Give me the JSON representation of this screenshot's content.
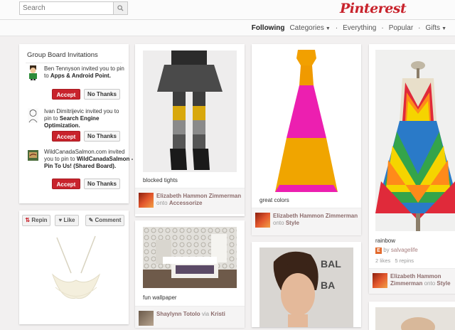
{
  "header": {
    "search_placeholder": "Search",
    "logo": "Pinterest",
    "brand_color": "#c8232c"
  },
  "nav": {
    "following": "Following",
    "categories": "Categories",
    "everything": "Everything",
    "popular": "Popular",
    "gifts": "Gifts"
  },
  "invitations": {
    "title": "Group Board Invitations",
    "items": [
      {
        "name": "Ben Tennyson",
        "middle": "invited you to pin to",
        "board": "Apps & Android Point",
        "end": "."
      },
      {
        "name": "Ivan Dimitrijevic",
        "middle": "invited you to pin to",
        "board": "Search Engine Optimization",
        "end": "."
      },
      {
        "name": "WildCanadaSalmon.com",
        "middle": "invited you to pin to",
        "board": "WildCanadaSalmon -Pin To Us! (Shared Board)",
        "end": "."
      }
    ],
    "accept_label": "Accept",
    "decline_label": "No Thanks"
  },
  "pin_actions": {
    "repin": "Repin",
    "like": "Like",
    "comment": "Comment"
  },
  "pins": {
    "blocked_tights": {
      "caption": "blocked tights",
      "user": "Elizabeth Hammon Zimmerman",
      "onto": "onto",
      "board": "Accessorize"
    },
    "fun_wallpaper": {
      "caption": "fun wallpaper",
      "user": "Shaylynn Totolo",
      "via": "via",
      "via_user": "Kristi"
    },
    "great_colors": {
      "caption": "great colors",
      "user": "Elizabeth Hammon Zimmerman",
      "onto": "onto",
      "board": "Style"
    },
    "rainbow": {
      "caption": "rainbow",
      "by": "by",
      "source": "salvagelife",
      "likes": "2 likes",
      "repins": "5 repins",
      "user": "Elizabeth Hammon Zimmerman",
      "onto": "onto",
      "board": "Style"
    }
  }
}
